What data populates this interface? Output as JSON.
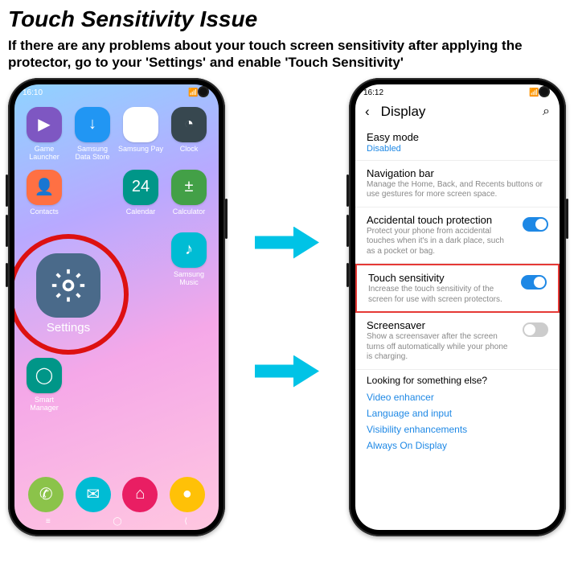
{
  "header": {
    "title": "Touch Sensitivity Issue",
    "subtitle": "If there are any problems about your touch screen sensitivity after applying the protector, go to your 'Settings' and enable 'Touch Sensitivity'"
  },
  "phone_left": {
    "status": {
      "time": "16:10",
      "extra": "⌂ ✉"
    },
    "apps": [
      {
        "label": "Game Launcher",
        "glyph": "▶",
        "color": "c-purple"
      },
      {
        "label": "Samsung Data Store",
        "glyph": "↓",
        "color": "c-blue"
      },
      {
        "label": "Samsung Pay",
        "glyph": "Pay",
        "color": "c-white"
      },
      {
        "label": "Clock",
        "glyph": "◔",
        "color": "c-dark"
      },
      {
        "label": "Contacts",
        "glyph": "👤",
        "color": "c-orange"
      },
      {
        "label": "Calendar",
        "glyph": "24",
        "color": "c-teal"
      },
      {
        "label": "Calculator",
        "glyph": "±",
        "color": "c-green"
      }
    ],
    "settings_label": "Settings",
    "side_apps": [
      {
        "label": "Samsung Music",
        "glyph": "♪",
        "color": "c-cyan"
      }
    ],
    "lower_apps": [
      {
        "label": "Smart Manager",
        "glyph": "◯",
        "color": "c-teal"
      }
    ],
    "dock": [
      {
        "glyph": "✆",
        "color": "c-lime"
      },
      {
        "glyph": "✉",
        "color": "c-cyan"
      },
      {
        "glyph": "⌂",
        "color": "c-pink"
      },
      {
        "glyph": "●",
        "color": "c-yellow"
      }
    ]
  },
  "phone_right": {
    "status": {
      "time": "16:12",
      "extra": "⌂ ✉"
    },
    "screen_title": "Display",
    "items": [
      {
        "title": "Easy mode",
        "value": "Disabled"
      },
      {
        "title": "Navigation bar",
        "desc": "Manage the Home, Back, and Recents buttons or use gestures for more screen space."
      },
      {
        "title": "Accidental touch protection",
        "desc": "Protect your phone from accidental touches when it's in a dark place, such as a pocket or bag.",
        "toggle": "on"
      },
      {
        "title": "Touch sensitivity",
        "desc": "Increase the touch sensitivity of the screen for use with screen protectors.",
        "toggle": "on",
        "highlight": true
      },
      {
        "title": "Screensaver",
        "desc": "Show a screensaver after the screen turns off automatically while your phone is charging.",
        "toggle": "off"
      }
    ],
    "footer": {
      "heading": "Looking for something else?",
      "links": [
        "Video enhancer",
        "Language and input",
        "Visibility enhancements",
        "Always On Display"
      ]
    }
  }
}
